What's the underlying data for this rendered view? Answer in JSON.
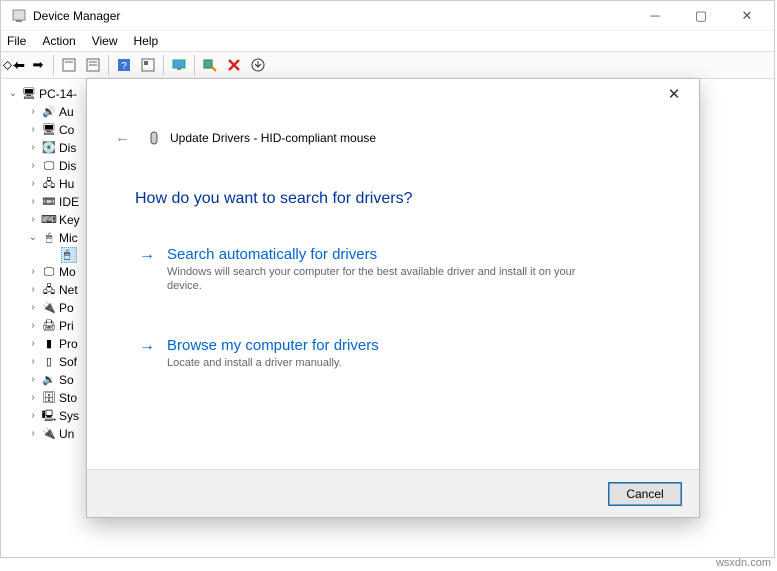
{
  "titlebar": {
    "title": "Device Manager"
  },
  "menu": {
    "file": "File",
    "action": "Action",
    "view": "View",
    "help": "Help"
  },
  "tree": {
    "root": "PC-14-",
    "items": [
      {
        "label": "Au",
        "icon": "🔊"
      },
      {
        "label": "Co",
        "icon": "🖥"
      },
      {
        "label": "Dis",
        "icon": "💽"
      },
      {
        "label": "Dis",
        "icon": "🖵"
      },
      {
        "label": "Hu",
        "icon": "🖧"
      },
      {
        "label": "IDE",
        "icon": "📼"
      },
      {
        "label": "Key",
        "icon": "⌨"
      },
      {
        "label": "Mic",
        "icon": "🖱",
        "expanded": true,
        "children": [
          {
            "label": "",
            "icon": "🖱"
          }
        ]
      },
      {
        "label": "Mo",
        "icon": "🖵"
      },
      {
        "label": "Net",
        "icon": "🖧"
      },
      {
        "label": "Po",
        "icon": "🔌"
      },
      {
        "label": "Pri",
        "icon": "🖨"
      },
      {
        "label": "Pro",
        "icon": "▮"
      },
      {
        "label": "Sof",
        "icon": "▯"
      },
      {
        "label": "So",
        "icon": "🔉"
      },
      {
        "label": "Sto",
        "icon": "🗄"
      },
      {
        "label": "Sys",
        "icon": "🖳"
      },
      {
        "label": "Un",
        "icon": "🔌"
      }
    ]
  },
  "dialog": {
    "header": "Update Drivers - HID-compliant mouse",
    "question": "How do you want to search for drivers?",
    "opt1": {
      "title": "Search automatically for drivers",
      "desc": "Windows will search your computer for the best available driver and install it on your device."
    },
    "opt2": {
      "title": "Browse my computer for drivers",
      "desc": "Locate and install a driver manually."
    },
    "cancel": "Cancel"
  },
  "watermark": "wsxdn.com"
}
